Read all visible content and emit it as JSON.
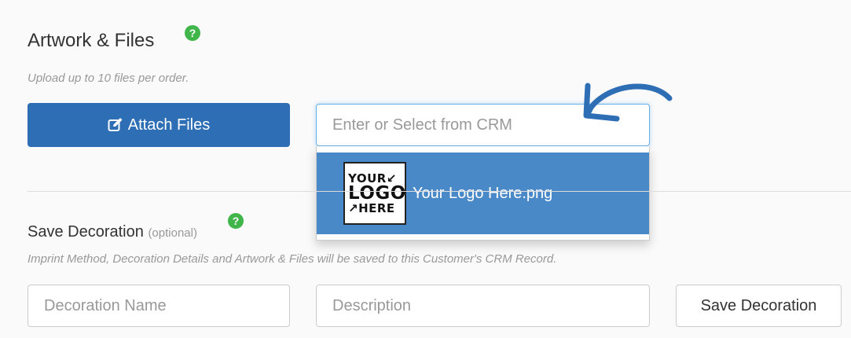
{
  "artwork": {
    "title": "Artwork & Files",
    "help_badge": "?",
    "upload_hint": "Upload up to 10 files per order.",
    "attach_button_label": "Attach Files",
    "attach_button_icon": "edit-icon",
    "crm_input": {
      "placeholder": "Enter or Select from CRM",
      "value": ""
    },
    "dropdown": {
      "items": [
        {
          "file_name": "Your Logo Here.png",
          "thumbnail_lines": [
            "YOUR",
            "LOGO",
            "HERE"
          ]
        }
      ]
    },
    "accent_color": "#2d6eb5",
    "highlight_color": "#4a89c8"
  },
  "save_decoration": {
    "title": "Save Decoration",
    "optional_label": "(optional)",
    "help_badge": "?",
    "hint": "Imprint Method, Decoration Details and Artwork & Files will be saved to this Customer's CRM Record.",
    "name_input": {
      "placeholder": "Decoration Name",
      "value": ""
    },
    "description_input": {
      "placeholder": "Description",
      "value": ""
    },
    "save_button_label": "Save Decoration"
  },
  "annotation": {
    "icon": "curved-arrow-icon",
    "color": "#2d6eb5"
  },
  "help_badge_color": "#3fb54a"
}
